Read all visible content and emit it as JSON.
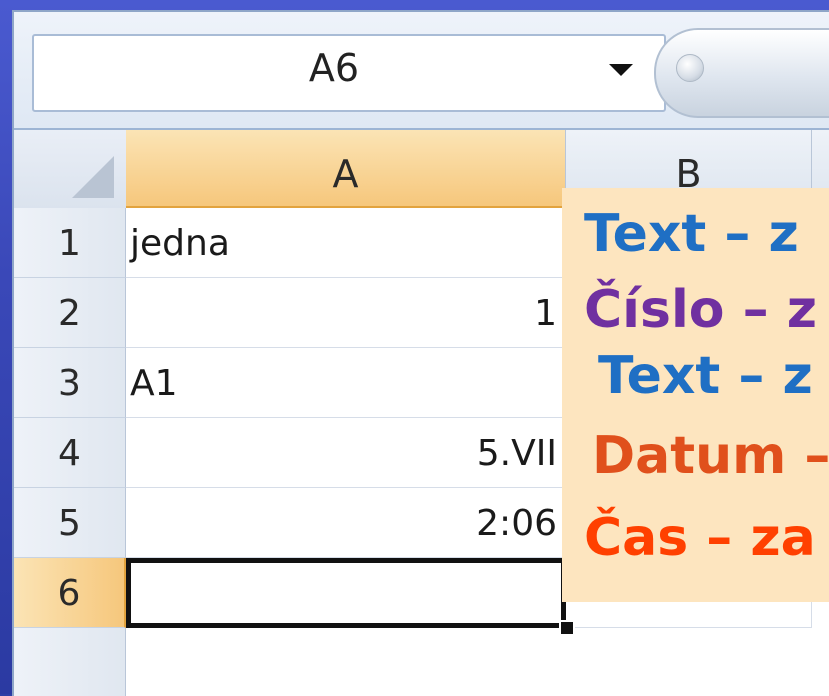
{
  "formula_bar": {
    "name_box_value": "A6"
  },
  "columns": [
    "A",
    "B"
  ],
  "rows": [
    {
      "number": "1",
      "a": "jedna",
      "align": "left"
    },
    {
      "number": "2",
      "a": "1",
      "align": "right"
    },
    {
      "number": "3",
      "a": "A1",
      "align": "left"
    },
    {
      "number": "4",
      "a": "5.VII",
      "align": "right"
    },
    {
      "number": "5",
      "a": "2:06",
      "align": "right"
    },
    {
      "number": "6",
      "a": "",
      "align": "left"
    }
  ],
  "annotations": [
    {
      "text": "Text – z",
      "color": "#1f6fc4"
    },
    {
      "text": "Číslo – z",
      "color": "#7030a0"
    },
    {
      "text": "Text – z",
      "color": "#1f6fc4"
    },
    {
      "text": "Datum –",
      "color": "#e0501c"
    },
    {
      "text": "Čas – za",
      "color": "#ff4000"
    }
  ],
  "colors": {
    "active_header": "#f6c77c",
    "annotation_bg": "#fde5bf",
    "frame": "#3a48b8"
  }
}
